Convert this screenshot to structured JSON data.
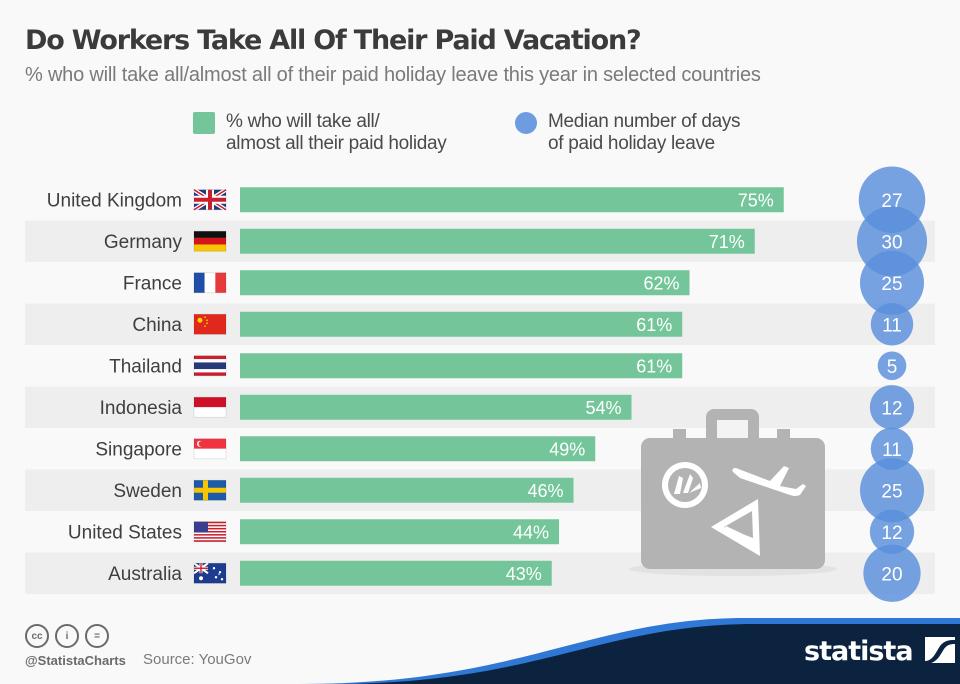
{
  "header": {
    "title": "Do Workers Take All Of Their Paid Vacation?",
    "subtitle": "% who will take all/almost all of their paid holiday leave this year in selected countries"
  },
  "legend": [
    {
      "label": "% who will take all/\nalmost all their paid holiday",
      "shape": "square",
      "color": "#74c69a"
    },
    {
      "label": "Median number of days\nof paid holiday leave",
      "shape": "circle",
      "color": "#6d9de0"
    }
  ],
  "chart_data": {
    "type": "bar",
    "title": "Do Workers Take All Of Their Paid Vacation?",
    "subtitle": "% who will take all/almost all of their paid holiday leave this year in selected countries",
    "categories": [
      "United Kingdom",
      "Germany",
      "France",
      "China",
      "Thailand",
      "Indonesia",
      "Singapore",
      "Sweden",
      "United States",
      "Australia"
    ],
    "series": [
      {
        "name": "% who will take all/almost all their paid holiday",
        "type": "bar",
        "unit": "%",
        "color": "#74c69a",
        "values": [
          75,
          71,
          62,
          61,
          61,
          54,
          49,
          46,
          44,
          43
        ]
      },
      {
        "name": "Median number of days of paid holiday leave",
        "type": "bubble",
        "color": "#5a8fdc",
        "values": [
          27,
          30,
          25,
          11,
          5,
          12,
          11,
          25,
          12,
          20
        ]
      }
    ],
    "xlim": [
      0,
      100
    ],
    "orientation": "horizontal",
    "grid": false,
    "legend_position": "top",
    "flags": [
      "uk-flag",
      "germany-flag",
      "france-flag",
      "china-flag",
      "thailand-flag",
      "indonesia-flag",
      "singapore-flag",
      "sweden-flag",
      "usa-flag",
      "australia-flag"
    ]
  },
  "footer": {
    "license_icons": [
      "cc-icon",
      "attribution-icon",
      "no-derivatives-icon"
    ],
    "license_glyphs": [
      "cc",
      "i",
      "="
    ],
    "handle": "@StatistaCharts",
    "source": "Source: YouGov",
    "brand": "statista"
  },
  "colors": {
    "bar": "#74c69a",
    "bubble": "#5a8fdc",
    "stripe": "#eeeeee",
    "background": "#f9f9f9",
    "suitcase": "#b3b3b3",
    "brand_dark": "#0c2340",
    "brand_blue": "#2f78d6"
  }
}
